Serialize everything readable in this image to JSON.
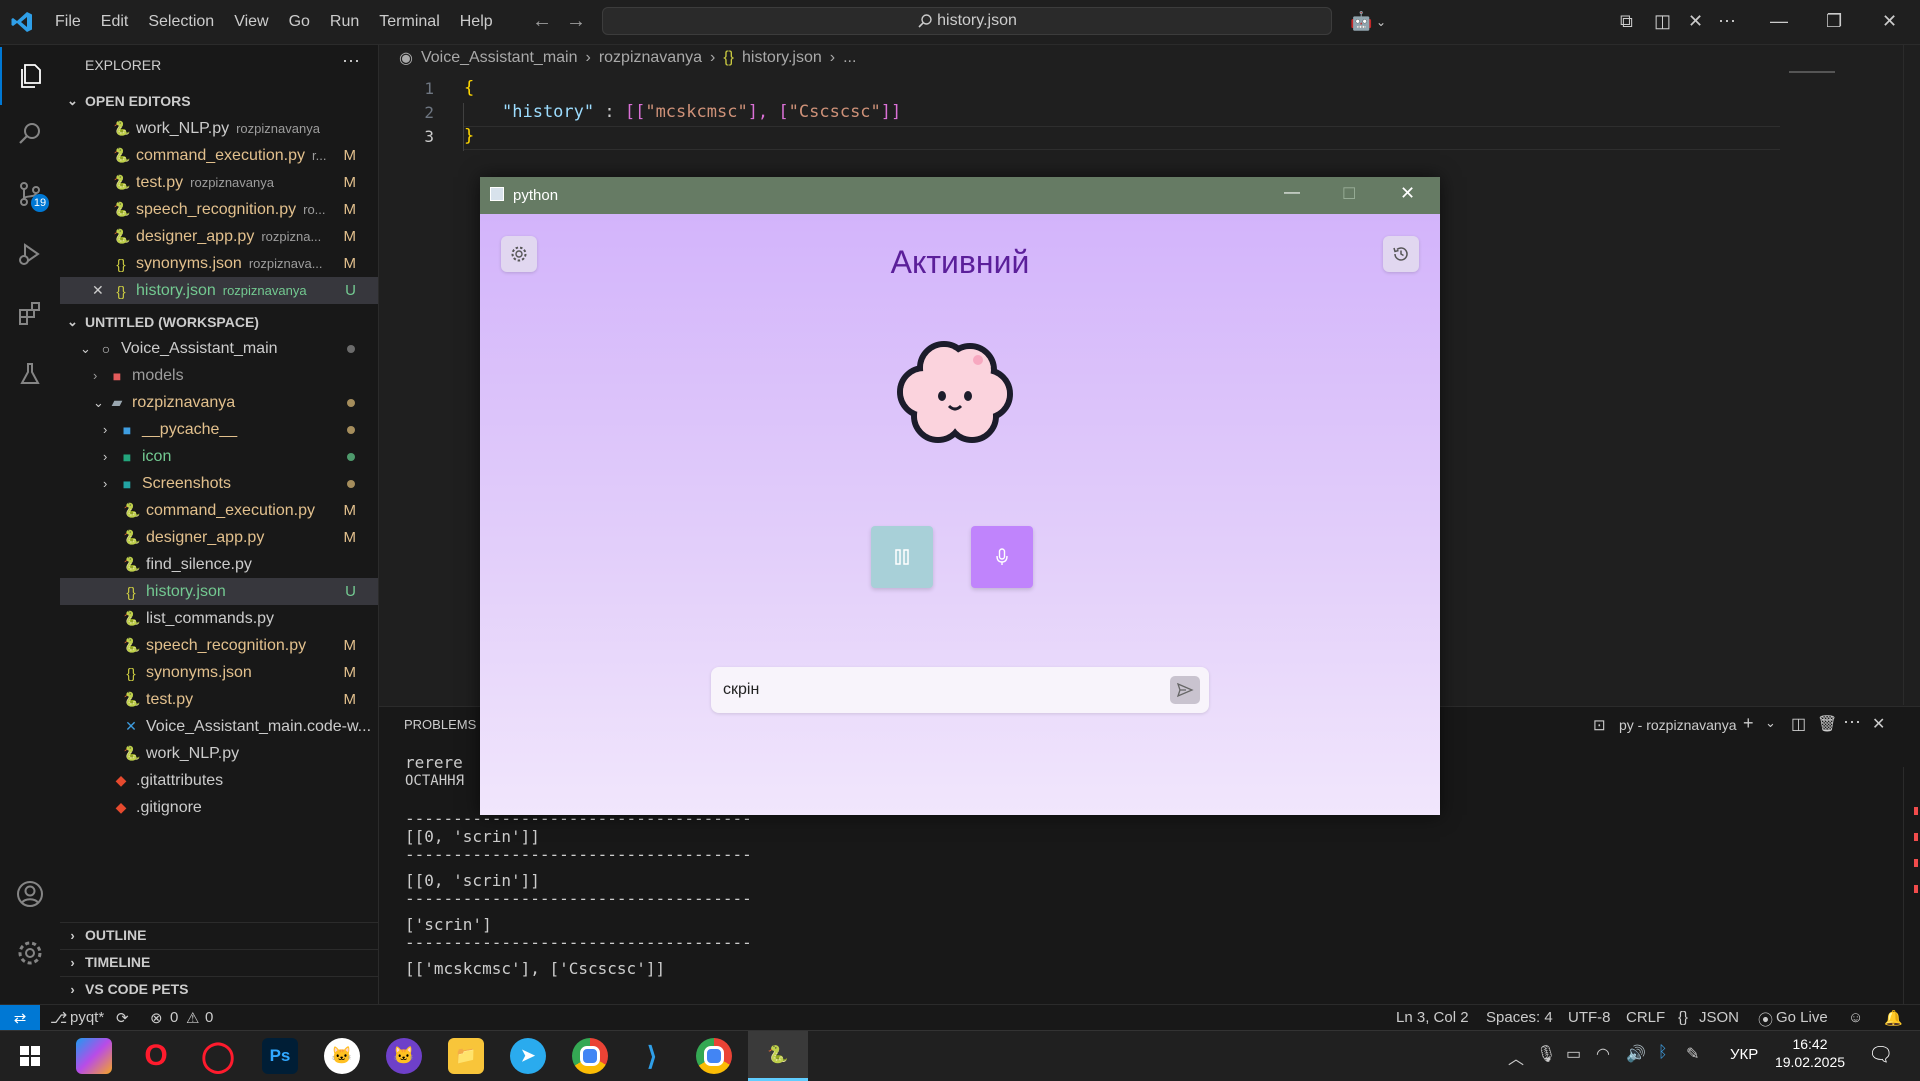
{
  "menu": [
    "File",
    "Edit",
    "Selection",
    "View",
    "Go",
    "Run",
    "Terminal",
    "Help"
  ],
  "command_center": "history.json",
  "scm_badge": "19",
  "explorer": {
    "title": "EXPLORER",
    "open_editors_title": "OPEN EDITORS",
    "open_editors": [
      {
        "name": "work_NLP.py",
        "dir": "rozpiznavanya",
        "status": ""
      },
      {
        "name": "command_execution.py",
        "dir": "r...",
        "status": "M"
      },
      {
        "name": "test.py",
        "dir": "rozpiznavanya",
        "status": "M"
      },
      {
        "name": "speech_recognition.py",
        "dir": "ro...",
        "status": "M"
      },
      {
        "name": "designer_app.py",
        "dir": "rozpizna...",
        "status": "M"
      },
      {
        "name": "synonyms.json",
        "dir": "rozpiznava...",
        "status": "M"
      },
      {
        "name": "history.json",
        "dir": "rozpiznavanya",
        "status": "U"
      }
    ],
    "workspace_title": "UNTITLED (WORKSPACE)",
    "tree": [
      {
        "name": "Voice_Assistant_main",
        "status": ""
      },
      {
        "name": "models",
        "status": ""
      },
      {
        "name": "rozpiznavanya",
        "status": ""
      },
      {
        "name": "__pycache__",
        "status": ""
      },
      {
        "name": "icon",
        "status": ""
      },
      {
        "name": "Screenshots",
        "status": ""
      },
      {
        "name": "command_execution.py",
        "status": "M"
      },
      {
        "name": "designer_app.py",
        "status": "M"
      },
      {
        "name": "find_silence.py",
        "status": ""
      },
      {
        "name": "history.json",
        "status": "U"
      },
      {
        "name": "list_commands.py",
        "status": ""
      },
      {
        "name": "speech_recognition.py",
        "status": "M"
      },
      {
        "name": "synonyms.json",
        "status": "M"
      },
      {
        "name": "test.py",
        "status": "M"
      },
      {
        "name": "Voice_Assistant_main.code-w...",
        "status": ""
      },
      {
        "name": "work_NLP.py",
        "status": ""
      },
      {
        "name": ".gitattributes",
        "status": ""
      },
      {
        "name": ".gitignore",
        "status": ""
      }
    ],
    "outline_title": "OUTLINE",
    "timeline_title": "TIMELINE",
    "pets_title": "VS CODE PETS"
  },
  "breadcrumb": [
    "Voice_Assistant_main",
    "rozpiznavanya",
    "history.json",
    "..."
  ],
  "editor": {
    "line_numbers": [
      "1",
      "2",
      "3"
    ],
    "line1": "{",
    "key": "\"history\"",
    "sep": " : ",
    "b1": "[[",
    "v1": "\"mcskcmsc\"",
    "c1": "], ",
    "b2": "[",
    "v2": "\"Cscscsc\"",
    "b3": "]]",
    "line3": "}"
  },
  "panel": {
    "tab": "PROBLEMS",
    "terminal_name": "py - rozpiznavanya",
    "lines": [
      "rerere",
      "ОСТАННЯ ",
      "",
      "------------------------------------",
      "[[0, 'scrin']]",
      "------------------------------------",
      "[[0, 'scrin']]",
      "------------------------------------",
      "['scrin']",
      "------------------------------------",
      "[['mcskcmsc'], ['Cscscsc']]"
    ]
  },
  "status": {
    "branch": "pyqt*",
    "errors": "0",
    "warnings": "0",
    "position": "Ln 3, Col 2",
    "spaces": "Spaces: 4",
    "encoding": "UTF-8",
    "eol": "CRLF",
    "language": "JSON",
    "golive": "Go Live"
  },
  "taskbar": {
    "lang": "УКР",
    "time": "16:42",
    "date": "19.02.2025"
  },
  "python_window": {
    "title": "python",
    "status": "Активний",
    "input_value": "скрін",
    "colors": {
      "titlebar": "#667b64",
      "pause_button": "#a8d0d8",
      "mic_button": "#c084fc",
      "status_text": "#5b1f9a"
    }
  }
}
